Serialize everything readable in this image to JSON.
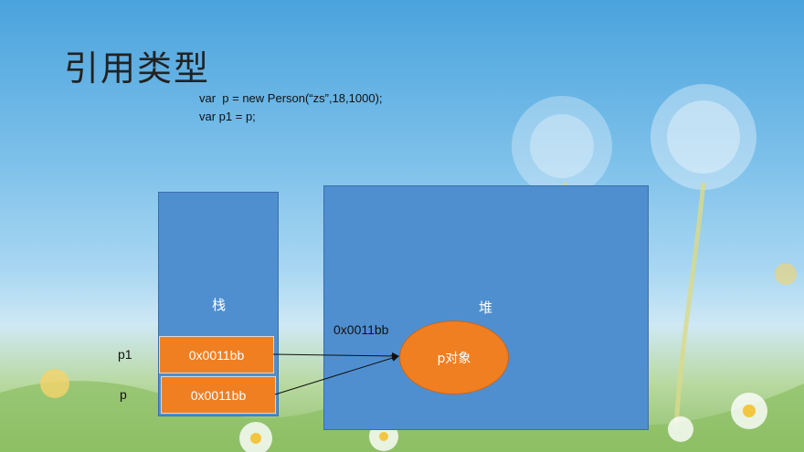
{
  "title": "引用类型",
  "code": {
    "line1": "var  p = new Person(“zs”,18,1000);",
    "line2": "var p1 = p;"
  },
  "stack": {
    "label": "栈",
    "cells": [
      {
        "var": "p1",
        "value": "0x0011bb"
      },
      {
        "var": "p",
        "value": "0x0011bb"
      }
    ]
  },
  "heap": {
    "label": "堆",
    "address": "0x0011bb",
    "object_label": "p对象"
  }
}
